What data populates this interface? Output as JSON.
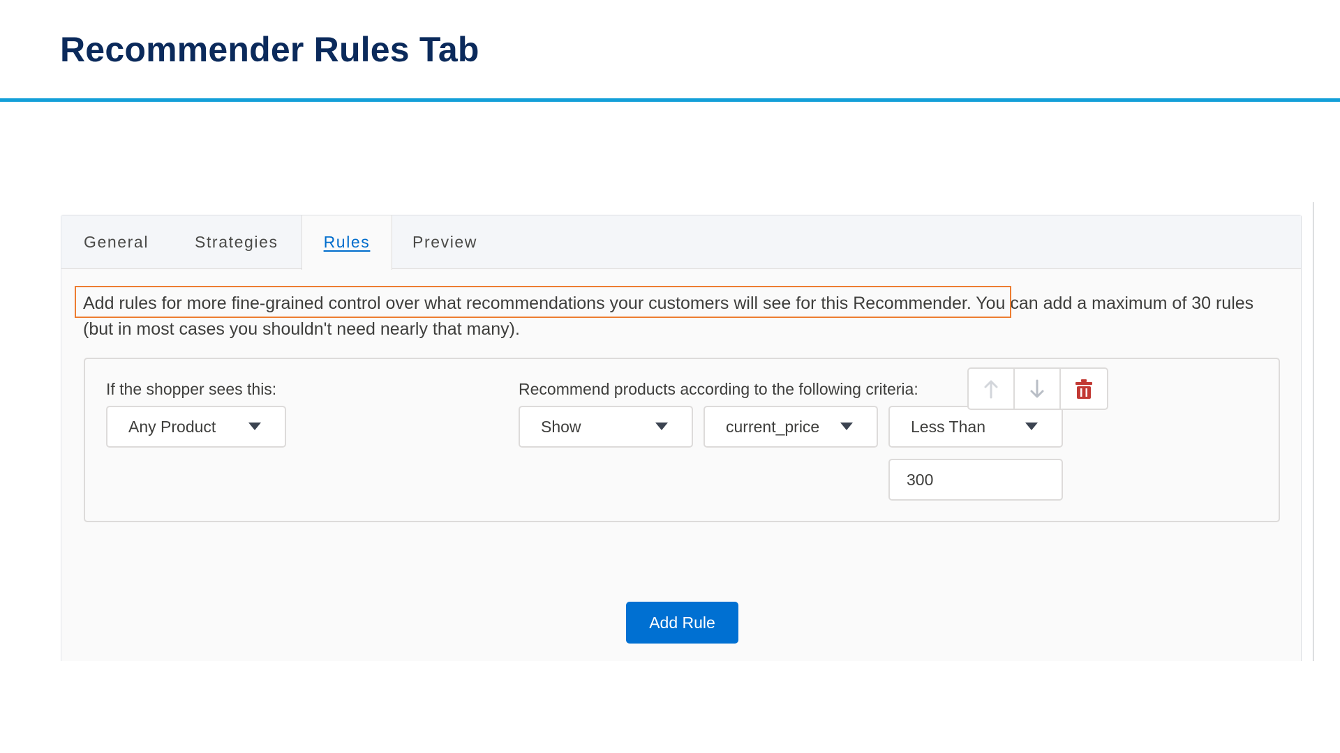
{
  "slide": {
    "title": "Recommender Rules Tab"
  },
  "tabs": [
    {
      "label": "General",
      "active": false
    },
    {
      "label": "Strategies",
      "active": false
    },
    {
      "label": "Rules",
      "active": true
    },
    {
      "label": "Preview",
      "active": false
    }
  ],
  "rules_tab": {
    "description": "Add rules for more fine-grained control over what recommendations your customers will see for this Recommender. You can add a maximum of 30 rules (but in most cases you shouldn't need nearly that many).",
    "highlight_color": "#ED7D31",
    "rule": {
      "condition_label": "If the shopper sees this:",
      "condition_value": "Any Product",
      "criteria_label": "Recommend products according to the following criteria:",
      "action_value": "Show",
      "attribute_value": "current_price",
      "operator_value": "Less Than",
      "value": "300",
      "controls": {
        "move_up_icon": "arrow-up-icon",
        "move_down_icon": "arrow-down-icon",
        "delete_icon": "trash-icon",
        "delete_color": "#C23934"
      }
    },
    "add_rule_label": "Add Rule",
    "accent_color": "#0070D2",
    "title_rule_color": "#139FD8"
  }
}
